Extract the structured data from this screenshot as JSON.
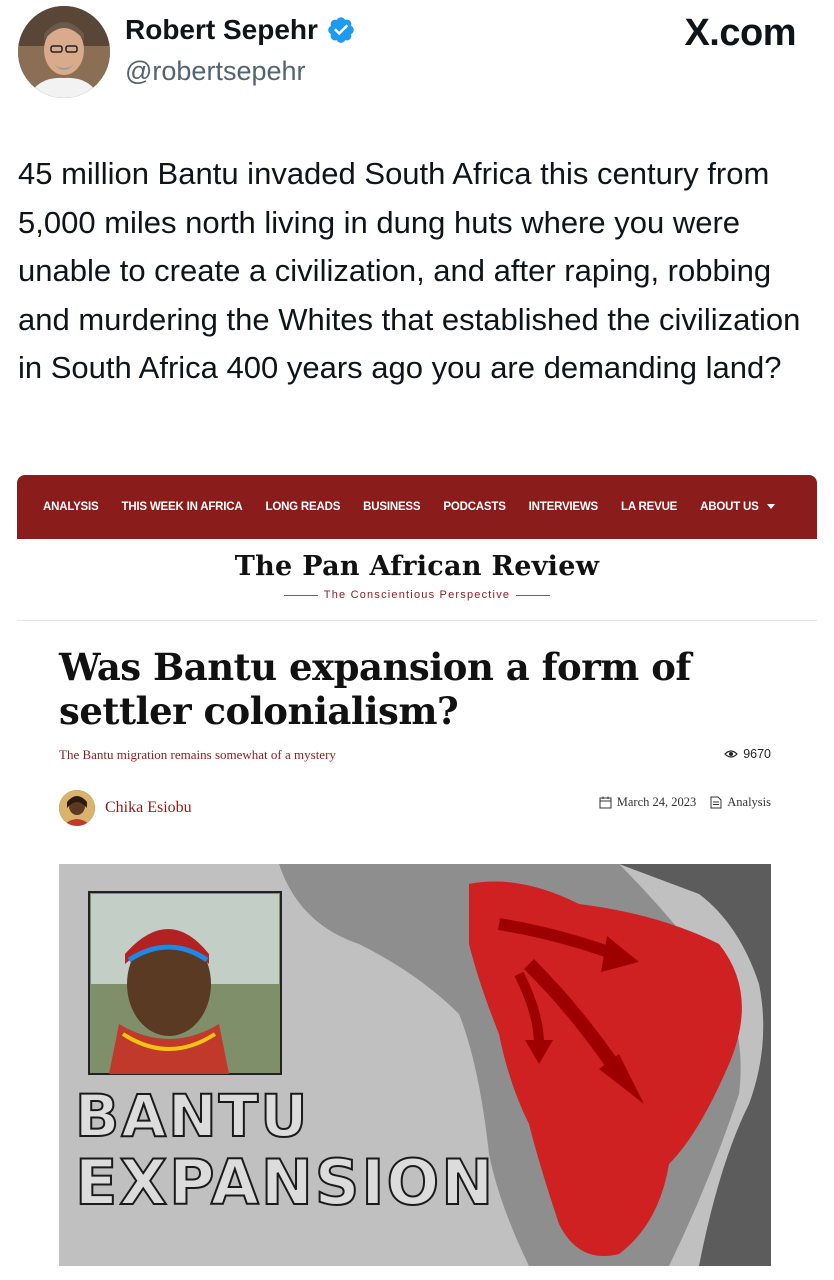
{
  "tweet": {
    "author_name": "Robert Sepehr",
    "handle": "@robertsepehr",
    "brand": "X.com",
    "icons": {
      "verified": "verified-badge-icon",
      "avatar": "profile-photo"
    },
    "text": "45 million Bantu invaded South Africa this century from 5,000 miles north living in dung huts where you were unable to create a civilization, and after raping, robbing and murdering the Whites that established the civilization in South Africa 400 years ago you are demanding land?"
  },
  "article": {
    "nav": {
      "items": [
        "ANALYSIS",
        "THIS WEEK IN AFRICA",
        "LONG READS",
        "BUSINESS",
        "PODCASTS",
        "INTERVIEWS",
        "LA REVUE",
        "ABOUT US"
      ],
      "color": "#8b1c1c"
    },
    "masthead": {
      "title": "The Pan African Review",
      "tagline": "The Conscientious Perspective"
    },
    "headline": "Was Bantu expansion a form of settler colonialism?",
    "subtitle": "The Bantu migration remains somewhat of a mystery",
    "views": "9670",
    "author": "Chika Esiobu",
    "date": "March 24, 2023",
    "category": "Analysis",
    "hero": {
      "line1": "BANTU",
      "line2": "EXPANSION"
    }
  }
}
